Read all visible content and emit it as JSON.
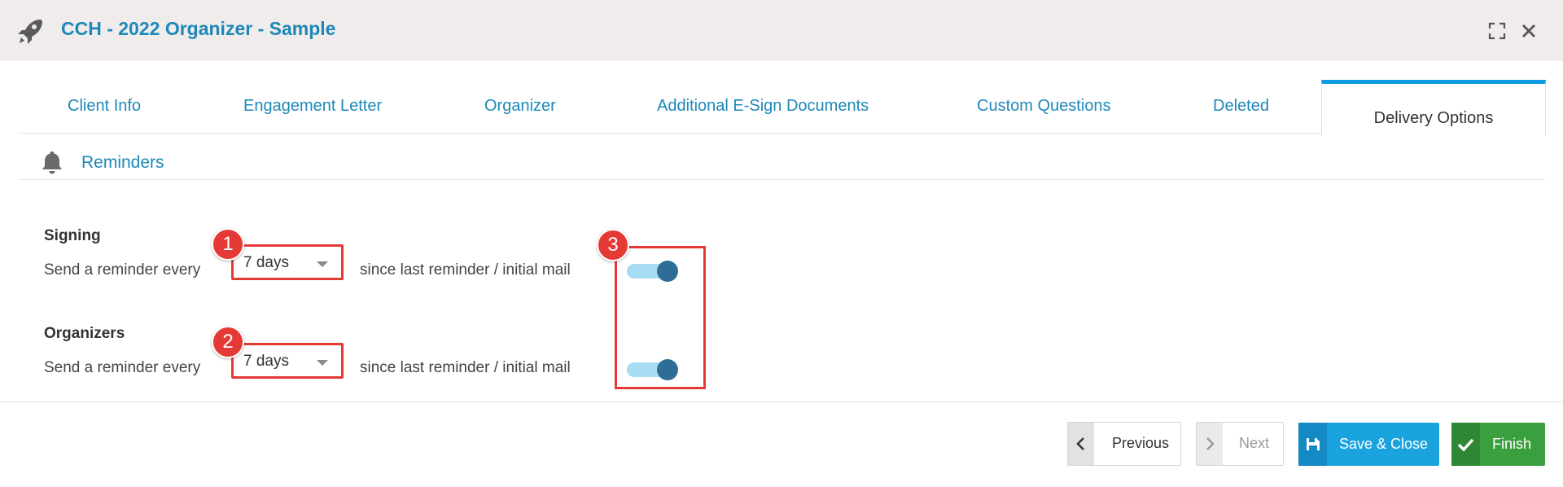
{
  "window": {
    "title": "CCH - 2022 Organizer - Sample",
    "app_icon": "rocket-icon",
    "controls": [
      "expand-icon",
      "close-icon"
    ]
  },
  "tabs": [
    {
      "label": "Client Info",
      "active": false
    },
    {
      "label": "Engagement Letter",
      "active": false
    },
    {
      "label": "Organizer",
      "active": false
    },
    {
      "label": "Additional E-Sign Documents",
      "active": false
    },
    {
      "label": "Custom Questions",
      "active": false
    },
    {
      "label": "Deleted",
      "active": false
    },
    {
      "label": "Delivery Options",
      "active": true
    }
  ],
  "section": {
    "title": "Reminders",
    "icon": "bell-icon"
  },
  "reminders": [
    {
      "group": "Signing",
      "label": "Send a reminder every",
      "interval": "7 days",
      "suffix": "since last reminder / initial mail",
      "enabled": true
    },
    {
      "group": "Organizers",
      "label": "Send a reminder every",
      "interval": "7 days",
      "suffix": "since last reminder / initial mail",
      "enabled": true
    }
  ],
  "annotations": [
    "1",
    "2",
    "3"
  ],
  "footer": {
    "previous": "Previous",
    "next": "Next",
    "save_close": "Save & Close",
    "finish": "Finish"
  },
  "colors": {
    "accent": "#1e88b8",
    "tab_active_border": "#0d99e0",
    "highlight": "#e53935",
    "toggle_track": "#a8dcf5",
    "toggle_knob": "#2e6e96",
    "save_button": "#1aa3de",
    "finish_button": "#3a9f3e"
  }
}
